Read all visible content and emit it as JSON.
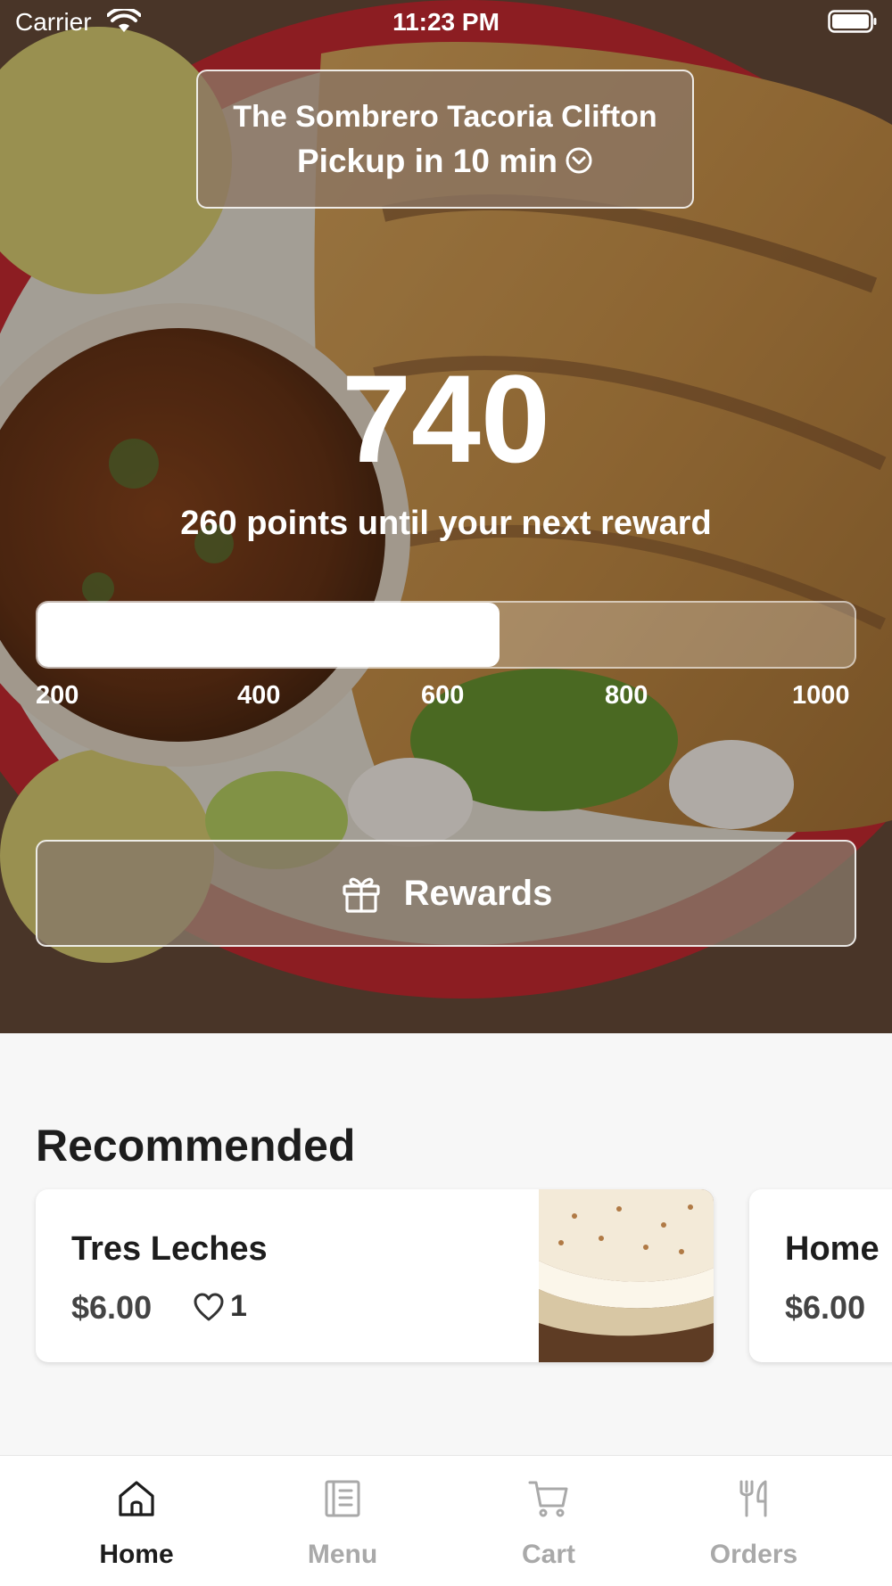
{
  "status_bar": {
    "carrier": "Carrier",
    "time": "11:23 PM"
  },
  "store": {
    "name": "The Sombrero Tacoria Clifton",
    "pickup": "Pickup in 10 min"
  },
  "rewards": {
    "points": "740",
    "points_caption": "260 points until your next reward",
    "progress_fraction": 0.5652,
    "ticks": [
      "200",
      "400",
      "600",
      "800",
      "1000"
    ],
    "button_label": "Rewards"
  },
  "recommended": {
    "title": "Recommended",
    "items": [
      {
        "name": "Tres Leches",
        "price": "$6.00",
        "likes": "1"
      },
      {
        "name": "Home",
        "price": "$6.00"
      }
    ]
  },
  "tabs": [
    {
      "label": "Home",
      "icon": "home-icon",
      "active": true
    },
    {
      "label": "Menu",
      "icon": "menu-icon",
      "active": false
    },
    {
      "label": "Cart",
      "icon": "cart-icon",
      "active": false
    },
    {
      "label": "Orders",
      "icon": "fork-knife-icon",
      "active": false
    }
  ],
  "colors": {
    "tab_active": "#1d1d1d",
    "tab_inactive": "#a9a9a9",
    "background": "#f7f7f7"
  }
}
